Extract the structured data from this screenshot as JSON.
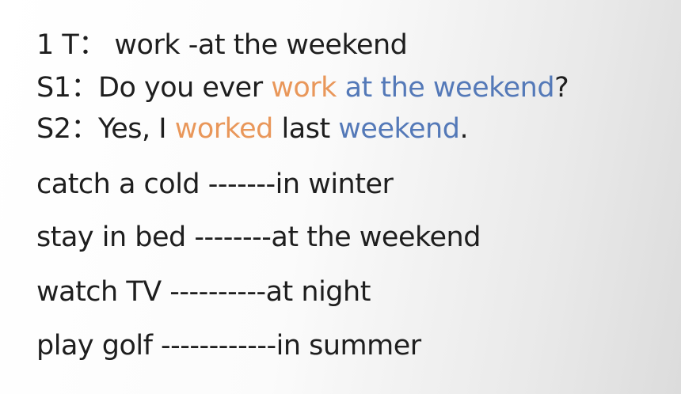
{
  "dialogue": {
    "t_line": {
      "label": "1 T：",
      "text": "work -at the weekend"
    },
    "s1": {
      "label": "S1：",
      "pre": "Do you ever ",
      "verb": "work",
      "space": " ",
      "time": "at the weekend",
      "end": "?"
    },
    "s2": {
      "label": "S2：",
      "pre": "Yes, I ",
      "verb": "worked",
      "mid": " last ",
      "time": "weekend",
      "end": "."
    }
  },
  "phrases": [
    {
      "activity": "catch a cold ",
      "dashes": "-------",
      "time": "in winter"
    },
    {
      "activity": "stay in bed ",
      "dashes": "--------",
      "time": "at the weekend"
    },
    {
      "activity": "watch TV ",
      "dashes": "----------",
      "time": "at night"
    },
    {
      "activity": "play golf ",
      "dashes": "------------",
      "time": "in summer"
    }
  ],
  "colors": {
    "verb": "#e9975a",
    "time": "#5479b8"
  }
}
